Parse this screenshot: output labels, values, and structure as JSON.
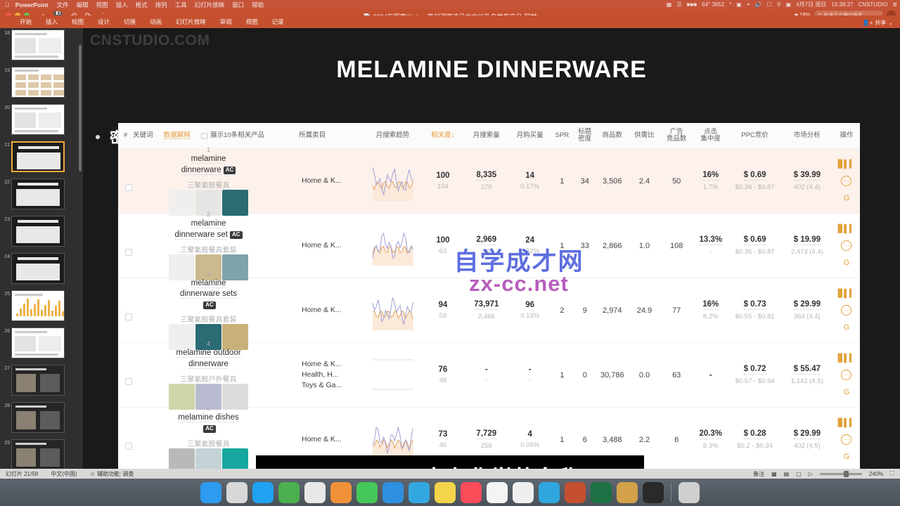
{
  "macbar": {
    "apple_icon": "apple-icon",
    "app_name": "PowerPoint",
    "menus": [
      "文件",
      "编辑",
      "视图",
      "插入",
      "格式",
      "排列",
      "工具",
      "幻灯片放映",
      "窗口",
      "帮助"
    ],
    "status_right": {
      "battery_label": "18%",
      "stats": "64° 3852",
      "date": "4月7日 周日",
      "time": "15:38:37",
      "user": "CNSTUDIO",
      "icons": [
        "chart-icon",
        "bars-icon",
        "battery-icon",
        "bluetooth-icon",
        "display-icon",
        "wifi-icon",
        "volume-icon",
        "screen-icon",
        "spotlight-search-icon",
        "calendar-icon",
        "control-center-icon"
      ]
    }
  },
  "window": {
    "document_title": "2024年厨房Kitchen高利润率选品方向以及自发货产品-阿甘",
    "doc_icon": "document-icon",
    "quick_access": [
      "home-icon",
      "save-icon",
      "undo-icon",
      "redo-icon",
      "more-icon"
    ],
    "zoom_level": "18%",
    "search_placeholder": "在演示文稿中搜索",
    "share_label": "共享",
    "ribbon_tabs": [
      "开始",
      "插入",
      "绘图",
      "设计",
      "切换",
      "动画",
      "幻灯片放映",
      "审阅",
      "视图",
      "记录"
    ]
  },
  "rail": {
    "slides": [
      {
        "number": "18",
        "selected": false,
        "style": "doc"
      },
      {
        "number": "19",
        "selected": false,
        "style": "grid"
      },
      {
        "number": "20",
        "selected": false,
        "style": "doc"
      },
      {
        "number": "21",
        "selected": true,
        "style": "dark"
      },
      {
        "number": "22",
        "selected": false,
        "style": "dark"
      },
      {
        "number": "23",
        "selected": false,
        "style": "dark"
      },
      {
        "number": "24",
        "selected": false,
        "style": "dark"
      },
      {
        "number": "25",
        "selected": false,
        "style": "chart"
      },
      {
        "number": "26",
        "selected": false,
        "style": "doc"
      },
      {
        "number": "27",
        "selected": false,
        "style": "photo"
      },
      {
        "number": "28",
        "selected": false,
        "style": "photo"
      },
      {
        "number": "29",
        "selected": false,
        "style": "photo"
      }
    ]
  },
  "slide": {
    "watermark": "CNSTUDIO.COM",
    "title": "MELAMINE DINNERWARE",
    "bullet_text": "密胺",
    "overlay_watermark_line1": "自学成才网",
    "overlay_watermark_line2": "zx-cc.net"
  },
  "table": {
    "headers": {
      "index": "#",
      "keyword": "关键词",
      "data_explain": "数据解释",
      "show_related": "展示10条相关产品",
      "category": "所属类目",
      "search_trend": "月搜索趋势",
      "relevance": "相关度",
      "relevance_arrow": "↓",
      "monthly_search": "月搜索量",
      "monthly_purchase": "月购买量",
      "spr": "SPR",
      "title_density_l1": "标题",
      "title_density_l2": "密度",
      "product_count": "商品数",
      "supply_demand": "供需比",
      "ad_competitors_l1": "广告",
      "ad_competitors_l2": "竞品数",
      "click_concentration_l1": "点击",
      "click_concentration_l2": "集中度",
      "ppc_bid": "PPC竞价",
      "market_analysis": "市场分析",
      "actions": "操作"
    },
    "rows": [
      {
        "index": "1",
        "keyword": "melamine dinnerware",
        "badge": "AC",
        "badge_inline": true,
        "keyword_cn": "三聚氰胺餐具",
        "categories": [
          "Home & K..."
        ],
        "relevance": "100",
        "relevance_sub": "104",
        "monthly_search": "8,335",
        "monthly_search_sub": "278",
        "monthly_purchase": "14",
        "monthly_purchase_sub": "0.17%",
        "spr": "1",
        "title_density": "34",
        "product_count": "3,506",
        "supply_demand": "2.4",
        "ad_competitors": "50",
        "click_concentration": "16%",
        "click_concentration_sub": "1.7%",
        "ppc_bid": "$ 0.69",
        "ppc_bid_sub": "$0.36 - $0.87",
        "market_price": "$ 39.99",
        "market_sub": "402 (4.4)",
        "highlighted": true
      },
      {
        "index": "2",
        "keyword": "melamine dinnerware set",
        "badge": "AC",
        "badge_inline": true,
        "keyword_cn": "三聚氰胺餐具套装",
        "categories": [
          "Home & K..."
        ],
        "relevance": "100",
        "relevance_sub": "63",
        "monthly_search": "2,969",
        "monthly_search_sub": "99",
        "monthly_purchase": "24",
        "monthly_purchase_sub": "0.82%",
        "spr": "1",
        "title_density": "33",
        "product_count": "2,866",
        "supply_demand": "1.0",
        "ad_competitors": "108",
        "click_concentration": "13.3%",
        "click_concentration_sub": "-",
        "ppc_bid": "$ 0.69",
        "ppc_bid_sub": "$0.36 - $0.87",
        "market_price": "$ 19.99",
        "market_sub": "2,473 (4.4)",
        "highlighted": false
      },
      {
        "index": "3",
        "keyword": "melamine dinnerware sets",
        "badge": "AC",
        "badge_inline": false,
        "keyword_cn": "三聚氰胺餐具套装",
        "categories": [
          "Home & K..."
        ],
        "relevance": "94",
        "relevance_sub": "59",
        "monthly_search": "73,971",
        "monthly_search_sub": "2,466",
        "monthly_purchase": "96",
        "monthly_purchase_sub": "0.13%",
        "spr": "2",
        "title_density": "9",
        "product_count": "2,974",
        "supply_demand": "24.9",
        "ad_competitors": "77",
        "click_concentration": "16%",
        "click_concentration_sub": "8.2%",
        "ppc_bid": "$ 0.73",
        "ppc_bid_sub": "$0.55 - $0.81",
        "market_price": "$ 29.99",
        "market_sub": "364 (4.4)",
        "highlighted": false
      },
      {
        "index": "4",
        "keyword": "melamine outdoor dinnerware",
        "badge": "",
        "badge_inline": true,
        "keyword_cn": "三聚氰胺户外餐具",
        "categories": [
          "Home & K...",
          "Health, H...",
          "Toys & Ga..."
        ],
        "relevance": "76",
        "relevance_sub": "48",
        "monthly_search": "-",
        "monthly_search_sub": "-",
        "monthly_purchase": "-",
        "monthly_purchase_sub": "-",
        "spr": "1",
        "title_density": "0",
        "product_count": "30,786",
        "supply_demand": "0.0",
        "ad_competitors": "63",
        "click_concentration": "-",
        "click_concentration_sub": "",
        "ppc_bid": "$ 0.72",
        "ppc_bid_sub": "$0.57 - $0.94",
        "market_price": "$ 55.47",
        "market_sub": "1,142 (4.5)",
        "highlighted": false
      },
      {
        "index": "5",
        "keyword": "melamine dishes",
        "badge": "AC",
        "badge_inline": false,
        "keyword_cn": "三聚氰胺餐具",
        "categories": [
          "Home & K..."
        ],
        "relevance": "73",
        "relevance_sub": "46",
        "monthly_search": "7,729",
        "monthly_search_sub": "258",
        "monthly_purchase": "4",
        "monthly_purchase_sub": "0.05%",
        "spr": "1",
        "title_density": "6",
        "product_count": "3,488",
        "supply_demand": "2.2",
        "ad_competitors": "6",
        "click_concentration": "20.3%",
        "click_concentration_sub": "8.3%",
        "ppc_bid": "$ 0.28",
        "ppc_bid_sub": "$0.2 - $0.34",
        "market_price": "$ 29.99",
        "market_sub": "402 (4.5)",
        "highlighted": false
      }
    ],
    "action_icons": [
      "bar-chart-icon",
      "smiley-icon",
      "google-icon"
    ]
  },
  "caption": {
    "text": "melamine它有化学的名称"
  },
  "statusbar": {
    "slide_counter": "幻灯片 21/58",
    "language": "中文(中国)",
    "accessibility": "辅助功能: 调查",
    "notes_label": "备注",
    "zoom_percent": "240%",
    "view_icons": [
      "normal-view-icon",
      "sorter-view-icon",
      "reading-view-icon",
      "slideshow-icon"
    ]
  },
  "dock": {
    "items": [
      {
        "name": "finder-icon",
        "color": "#2d9bf0"
      },
      {
        "name": "launchpad-icon",
        "color": "#d8d8d8"
      },
      {
        "name": "safari-icon",
        "color": "#1fa2f0"
      },
      {
        "name": "wechat-icon",
        "color": "#4caf50"
      },
      {
        "name": "chrome-icon",
        "color": "#e8e8e8"
      },
      {
        "name": "design-app-icon",
        "color": "#f0913a"
      },
      {
        "name": "messages-icon",
        "color": "#45c759"
      },
      {
        "name": "mail-icon",
        "color": "#2f8fe0"
      },
      {
        "name": "qq-icon",
        "color": "#33a8e0"
      },
      {
        "name": "notes-icon",
        "color": "#f3d44a"
      },
      {
        "name": "music-icon",
        "color": "#fb4c5a"
      },
      {
        "name": "calendar-icon",
        "color": "#f4f4f4"
      },
      {
        "name": "photos-icon",
        "color": "#efefef"
      },
      {
        "name": "keynote-icon",
        "color": "#2fa6dd"
      },
      {
        "name": "powerpoint-icon",
        "color": "#c4502f"
      },
      {
        "name": "excel-icon",
        "color": "#1e7145"
      },
      {
        "name": "folder-icon",
        "color": "#d3a14a"
      },
      {
        "name": "terminal-icon",
        "color": "#2a2a2a"
      },
      {
        "name": "trash-icon",
        "color": "#cfcfcf"
      }
    ]
  }
}
